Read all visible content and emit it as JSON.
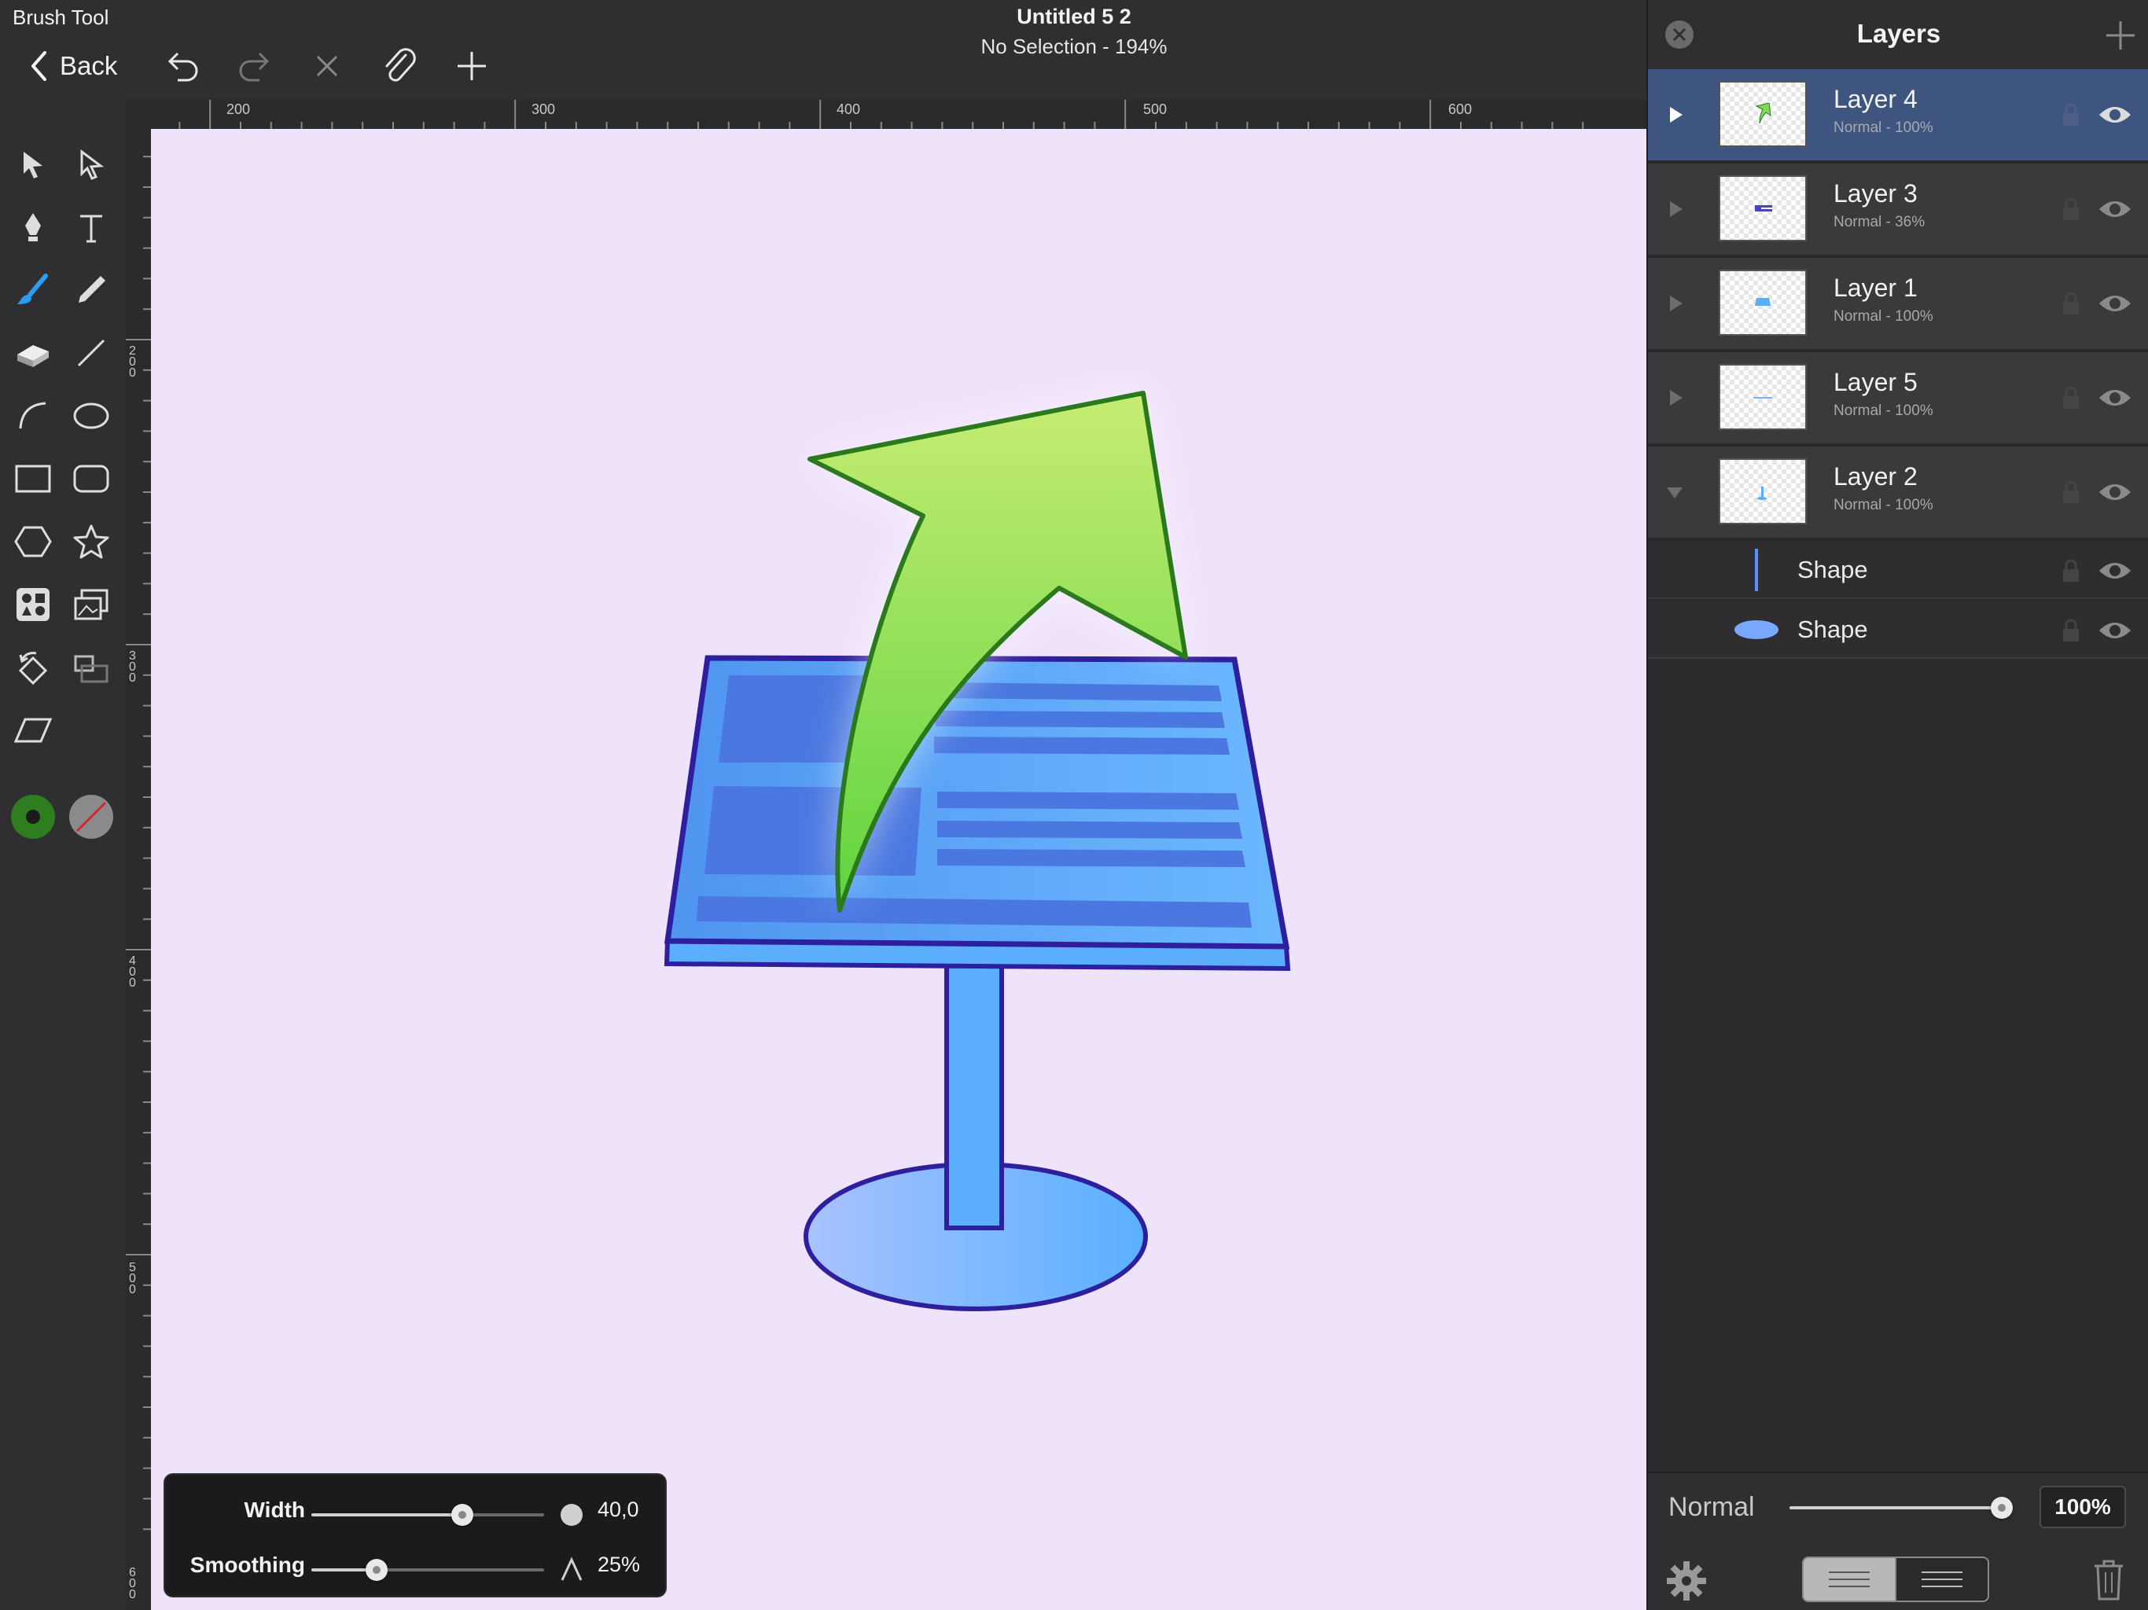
{
  "app": {
    "tool_name": "Brush Tool",
    "back_label": "Back",
    "doc_title": "Untitled 5 2",
    "doc_subtitle": "No Selection - 194%"
  },
  "toolbar_icons": [
    "undo-icon",
    "redo-icon",
    "close-icon",
    "paperclip-icon",
    "add-icon"
  ],
  "rulers": {
    "top_labels": [
      "200",
      "300",
      "400",
      "500",
      "600"
    ],
    "left_labels": [
      "200",
      "300",
      "400",
      "500",
      "600"
    ]
  },
  "tools": [
    "selection-arrow",
    "direct-selection-arrow",
    "pen",
    "text",
    "brush",
    "pencil",
    "eraser",
    "line",
    "arc",
    "ellipse",
    "rectangle",
    "rounded-rectangle",
    "hexagon",
    "star",
    "symbols",
    "images",
    "transform",
    "crop",
    "skew"
  ],
  "colors": {
    "stroke_color": "#2e7d1f",
    "fill_color": "none",
    "accent": "#2a9df4",
    "canvas_bg": "#efe2fb",
    "selected_row": "#3e5580"
  },
  "layers_panel": {
    "title": "Layers",
    "layers": [
      {
        "name": "Layer 4",
        "sub": "Normal - 100%"
      },
      {
        "name": "Layer 3",
        "sub": "Normal - 36%"
      },
      {
        "name": "Layer 1",
        "sub": "Normal - 100%"
      },
      {
        "name": "Layer 5",
        "sub": "Normal - 100%"
      },
      {
        "name": "Layer 2",
        "sub": "Normal - 100%"
      }
    ],
    "shapes": [
      {
        "name": "Shape"
      },
      {
        "name": "Shape"
      }
    ],
    "blend_mode": "Normal",
    "opacity": "100%"
  },
  "brush_panel": {
    "width_label": "Width",
    "width_value": "40,0",
    "width_fraction": 0.65,
    "smoothing_label": "Smoothing",
    "smoothing_value": "25%",
    "smoothing_fraction": 0.28
  }
}
